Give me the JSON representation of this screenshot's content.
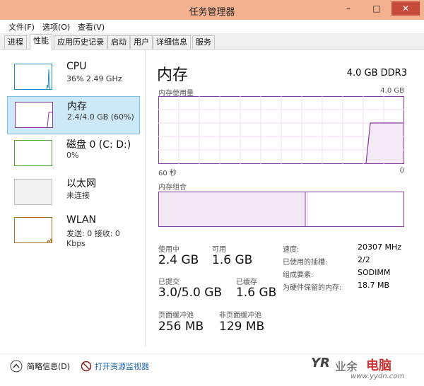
{
  "window": {
    "title": "任务管理器",
    "minimize": "–",
    "maximize": "□",
    "close": "✕"
  },
  "menu": [
    "文件(F)",
    "选项(O)",
    "查看(V)"
  ],
  "tabs": [
    "进程",
    "性能",
    "应用历史记录",
    "启动",
    "用户",
    "详细信息",
    "服务"
  ],
  "active_tab": "性能",
  "sidebar": {
    "items": [
      {
        "title": "CPU",
        "sub": "36% 2.49 GHz",
        "color": "#1f8ac0"
      },
      {
        "title": "内存",
        "sub": "2.4/4.0 GB (60%)",
        "color": "#8b39a8"
      },
      {
        "title": "磁盘 0 (C: D:)",
        "sub": "0%",
        "color": "#4fa031"
      },
      {
        "title": "以太网",
        "sub": "未连接",
        "color": "#a0a0a0"
      },
      {
        "title": "WLAN",
        "sub": "发送: 0 接收: 0 Kbps",
        "color": "#a86a1b"
      }
    ]
  },
  "memory": {
    "heading": "内存",
    "spec": "4.0 GB DDR3",
    "usage_label": "内存使用量",
    "usage_max": "4.0 GB",
    "time_left": "60 秒",
    "time_right": "0",
    "composition_label": "内存组合",
    "stats": {
      "in_use_label": "使用中",
      "in_use": "2.4 GB",
      "available_label": "可用",
      "available": "1.6 GB",
      "committed_label": "已提交",
      "committed": "3.0/5.0 GB",
      "cached_label": "已缓存",
      "cached": "1.6 GB",
      "paged_label": "页面缓冲池",
      "paged": "256 MB",
      "nonpaged_label": "非页面缓冲池",
      "nonpaged": "129 MB"
    },
    "details": [
      {
        "label": "速度:",
        "value": "20307 MHz"
      },
      {
        "label": "已使用的插槽:",
        "value": "2/2"
      },
      {
        "label": "组成要素:",
        "value": "SODIMM"
      },
      {
        "label": "为硬件保留的内存:",
        "value": "18.7 MB"
      }
    ]
  },
  "footer": {
    "summary": "简略信息(D)",
    "open_monitor": "打开资源监视器",
    "watermark_brand": "电脑",
    "watermark_url": "www.yydn.com"
  },
  "colors": {
    "memory": "#8b39a8",
    "titlebar": "#f4b18f"
  }
}
